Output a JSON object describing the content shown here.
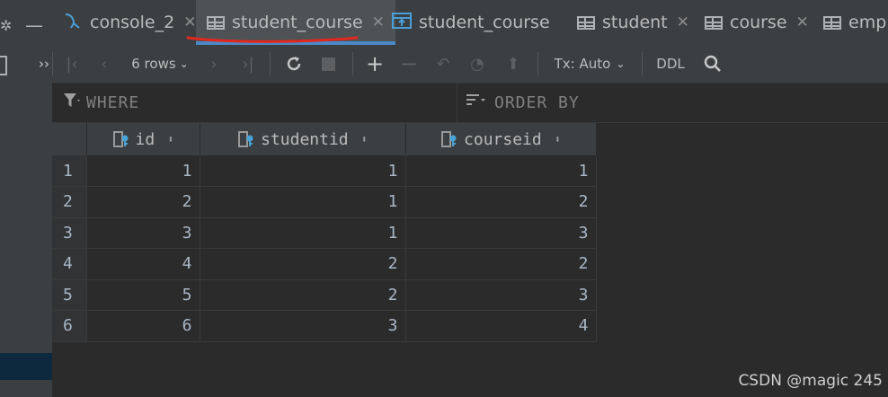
{
  "tabs": [
    {
      "label": "console_2",
      "icon": "console-icon",
      "active": false
    },
    {
      "label": "student_course",
      "icon": "table-icon",
      "active": true
    },
    {
      "label": "student_course",
      "icon": "table-diagram-icon",
      "active": false
    },
    {
      "label": "student",
      "icon": "table-icon",
      "active": false
    },
    {
      "label": "course",
      "icon": "table-icon",
      "active": false
    },
    {
      "label": "emp",
      "icon": "table-icon",
      "active": false
    }
  ],
  "toolbar": {
    "rows_label": "6 rows",
    "tx_label": "Tx: Auto",
    "ddl_label": "DDL",
    "more_label": "››"
  },
  "filters": {
    "where_label": "WHERE",
    "order_label": "ORDER BY"
  },
  "grid": {
    "columns": [
      "id",
      "studentid",
      "courseid"
    ],
    "rows": [
      {
        "num": "1",
        "cells": [
          "1",
          "1",
          "1"
        ]
      },
      {
        "num": "2",
        "cells": [
          "2",
          "1",
          "2"
        ]
      },
      {
        "num": "3",
        "cells": [
          "3",
          "1",
          "3"
        ]
      },
      {
        "num": "4",
        "cells": [
          "4",
          "2",
          "2"
        ]
      },
      {
        "num": "5",
        "cells": [
          "5",
          "2",
          "3"
        ]
      },
      {
        "num": "6",
        "cells": [
          "6",
          "3",
          "4"
        ]
      }
    ]
  },
  "watermark": "CSDN @magic 245",
  "colors": {
    "accent": "#4a88c7",
    "annotation": "#e0281e",
    "key_icon": "#4aa3d8"
  }
}
